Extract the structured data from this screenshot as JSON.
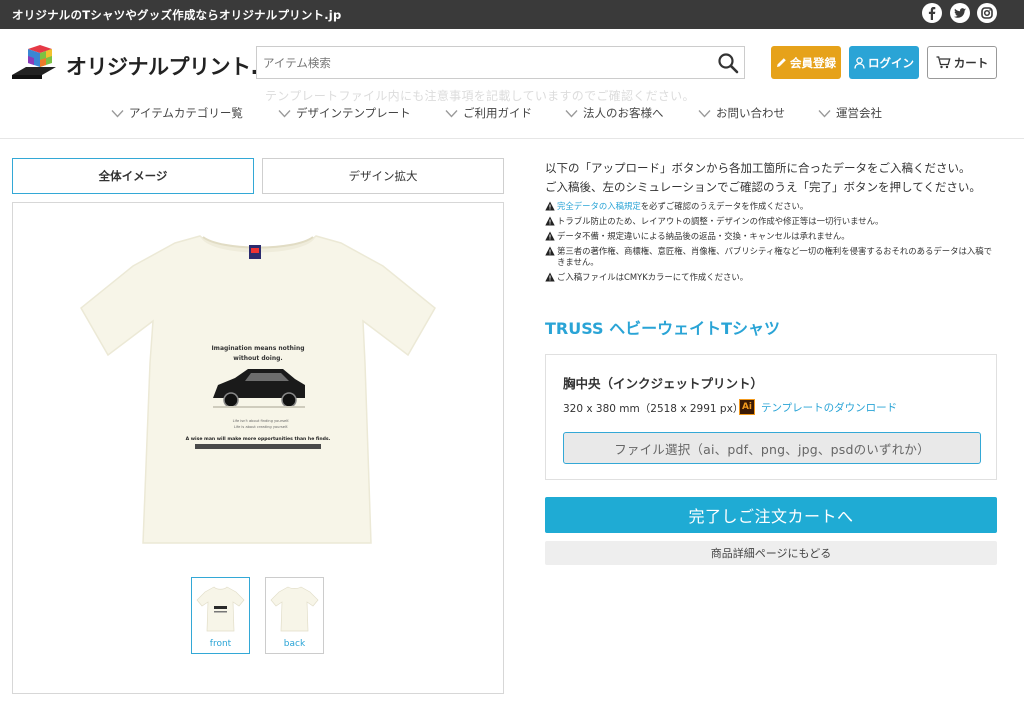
{
  "topbar": {
    "tagline": "オリジナルのTシャツやグッズ作成ならオリジナルプリント.jp",
    "social": [
      "facebook-icon",
      "twitter-icon",
      "instagram-icon"
    ]
  },
  "header": {
    "logo_text": "オリジナルプリント.jp",
    "search_placeholder": "アイテム検索",
    "ghost_text": "テンプレートファイル内にも注意事項を記載していますのでご確認ください。",
    "register_label": "会員登録",
    "login_label": "ログイン",
    "cart_label": "カート"
  },
  "nav": {
    "items": [
      "アイテムカテゴリー覧",
      "デザインテンプレート",
      "ご利用ガイド",
      "法人のお客様へ",
      "お問い合わせ",
      "運営会社"
    ]
  },
  "tabs": {
    "overall": "全体イメージ",
    "zoom": "デザイン拡大"
  },
  "shirt_design": {
    "headline_1": "Imagination means nothing",
    "headline_2": "without doing.",
    "small_1": "Life isn't about finding yourself.",
    "small_2": "Life is about creating yourself.",
    "bottom_line": "A wise man will make more opportunities than he finds."
  },
  "thumbs": {
    "front": "front",
    "back": "back"
  },
  "right": {
    "intro_1": "以下の「アップロード」ボタンから各加工箇所に合ったデータをご入稿ください。",
    "intro_2": "ご入稿後、左のシミュレーションでご確認のうえ「完了」ボタンを押してください。",
    "notice_1_link": "完全データの入稿規定",
    "notice_1_rest": "を必ずご確認のうえデータを作成ください。",
    "notice_2": "トラブル防止のため、レイアウトの調整・デザインの作成や修正等は一切行いません。",
    "notice_3": "データ不備・規定違いによる納品後の返品・交換・キャンセルは承れません。",
    "notice_4": "第三者の著作権、商標権、意匠権、肖像権、パブリシティ権など一切の権利を侵害するおそれのあるデータは入稿できません。",
    "notice_5": "ご入稿ファイルはCMYKカラーにて作成ください。",
    "product_title": "TRUSS ヘビーウェイトTシャツ",
    "location_title": "胸中央（インクジェットプリント）",
    "size": "320 x 380 mm（2518 x 2991 px）",
    "ai_icon": "Ai",
    "template_link": "テンプレートのダウンロード",
    "file_button": "ファイル選択（ai、pdf、png、jpg、psdのいずれか）",
    "complete_button": "完了しご注文カートへ",
    "back_button": "商品詳細ページにもどる"
  },
  "colors": {
    "accent": "#2aa4d6",
    "register": "#e6a21a",
    "topbar": "#3a3a3a",
    "shirt": "#f7f5e8"
  }
}
